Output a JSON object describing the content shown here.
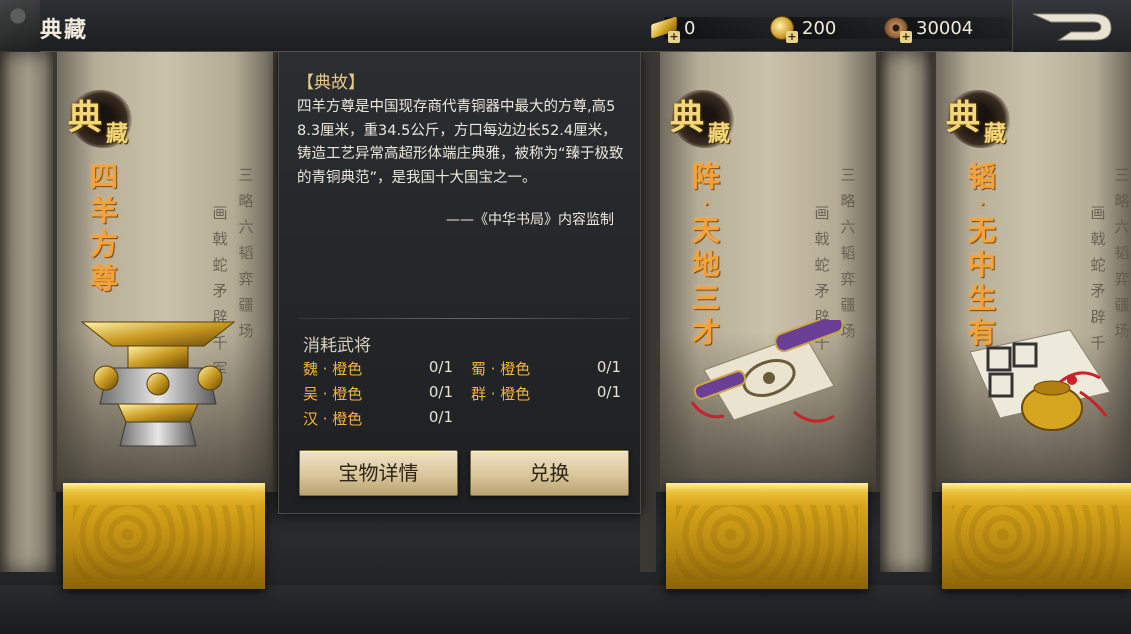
{
  "header": {
    "title": "典藏",
    "resources": [
      {
        "icon": "gold-ingot-icon",
        "value": "0"
      },
      {
        "icon": "gold-coin-icon",
        "value": "200"
      },
      {
        "icon": "copper-coin-icon",
        "value": "30004"
      }
    ],
    "back_icon": "return-arrow-icon"
  },
  "badge": {
    "char1": "典",
    "char2": "藏"
  },
  "exhibits": [
    {
      "title_chars": [
        "四",
        "羊",
        "方",
        "尊"
      ],
      "artifact_icon": "bronze-vessel-icon",
      "poem_chars": [
        "三",
        "略",
        "六",
        "韬",
        "弈",
        "疆",
        "场",
        "画",
        "戟",
        "蛇",
        "矛",
        "辟",
        "千",
        "军"
      ]
    },
    {
      "title_chars": [
        "阵",
        "·",
        "天",
        "地",
        "三",
        "才"
      ],
      "artifact_icon": "scroll-icon",
      "poem_chars": [
        "三",
        "略",
        "六",
        "韬",
        "弈",
        "疆",
        "场",
        "画",
        "戟",
        "蛇",
        "矛",
        "辟",
        "千"
      ]
    },
    {
      "title_chars": [
        "韬",
        "·",
        "无",
        "中",
        "生",
        "有"
      ],
      "artifact_icon": "scroll-pouch-icon",
      "poem_chars": [
        "三",
        "略",
        "六",
        "韬",
        "弈",
        "疆",
        "场",
        "画",
        "戟",
        "蛇",
        "矛",
        "辟",
        "千"
      ]
    }
  ],
  "panel": {
    "heading": "【典故】",
    "text": "四羊方尊是中国现存商代青铜器中最大的方尊,高58.3厘米，重34.5公斤，方口每边边长52.4厘米，铸造工艺异常高超形体端庄典雅，被称为“臻于极致的青铜典范”，是我国十大国宝之一。",
    "credit": "——《中华书局》内容监制",
    "consume_title": "消耗武将",
    "requirements": [
      {
        "name": "魏 · 橙色",
        "count": "0/1"
      },
      {
        "name": "蜀 · 橙色",
        "count": "0/1"
      },
      {
        "name": "吴 · 橙色",
        "count": "0/1"
      },
      {
        "name": "群 · 橙色",
        "count": "0/1"
      },
      {
        "name": "汉 · 橙色",
        "count": "0/1"
      }
    ],
    "detail_button": "宝物详情",
    "exchange_button": "兑换"
  }
}
